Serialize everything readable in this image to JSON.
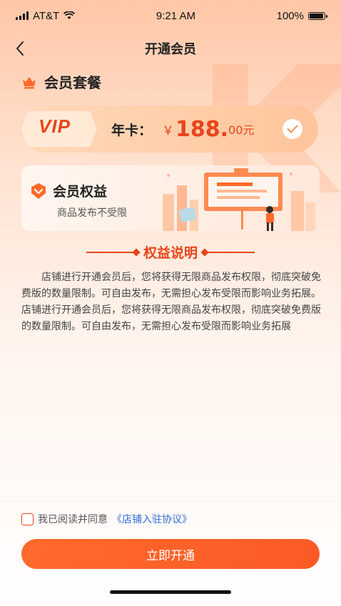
{
  "status_bar": {
    "carrier": "AT&T",
    "time": "9:21 AM",
    "battery": "100%"
  },
  "nav": {
    "title": "开通会员"
  },
  "section": {
    "title": "会员套餐"
  },
  "vip_plan": {
    "badge": "VIP",
    "name": "年卡：",
    "currency": "￥",
    "price_main": "188.",
    "price_sub": "00元",
    "selected": true
  },
  "benefit": {
    "title": "会员权益",
    "subtitle": "商品发布不受限"
  },
  "description": {
    "title": "权益说明",
    "body": "店铺进行开通会员后，您将获得无限商品发布权限，彻底突破免费版的数量限制。可自由发布，无需担心发布受限而影响业务拓展。店铺进行开通会员后，您将获得无限商品发布权限，彻底突破免费版的数量限制。可自由发布，无需担心发布受限而影响业务拓展"
  },
  "agreement": {
    "prefix": "我已阅读并同意",
    "link": "《店铺入驻协议》",
    "checked": false
  },
  "submit": {
    "label": "立即开通"
  },
  "colors": {
    "accent": "#e8451c",
    "button": "#fb5a26",
    "link": "#2f6bd8"
  },
  "icons": {
    "back": "chevron-left-icon",
    "crown": "crown-icon",
    "check": "check-icon",
    "benefit": "heart-badge-icon"
  }
}
